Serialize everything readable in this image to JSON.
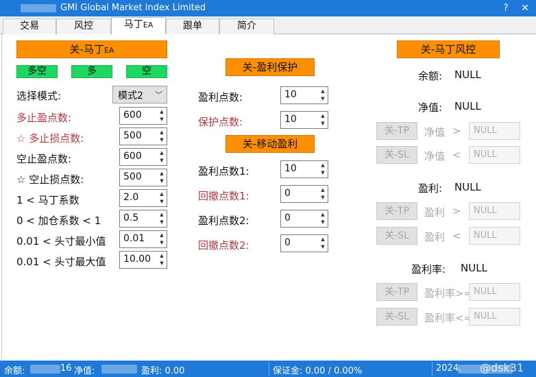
{
  "window": {
    "title": "GMI Global Market Index Limited",
    "help_glyph": "?",
    "close_glyph": "✕"
  },
  "tabs": [
    {
      "label": "交易"
    },
    {
      "label": "风控"
    },
    {
      "label": "马丁",
      "sub": "EA"
    },
    {
      "label": "跟单"
    },
    {
      "label": "简介"
    }
  ],
  "left": {
    "toggle_main": {
      "label": "关-马丁",
      "sub": "EA"
    },
    "direction_buttons": [
      "多空",
      "多",
      "空"
    ],
    "mode": {
      "label": "选择模式:",
      "value": "模式2"
    },
    "params": [
      {
        "label": "多止盈点数:",
        "value": "600"
      },
      {
        "label": "☆ 多止损点数:",
        "value": "500"
      },
      {
        "label": "空止盈点数:",
        "value": "600"
      },
      {
        "label": "☆ 空止损点数:",
        "value": "500"
      },
      {
        "label": "1 < 马丁系数",
        "value": "2.0"
      },
      {
        "label": "0 < 加仓系数 < 1",
        "value": "0.5"
      },
      {
        "label": "0.01 < 头寸最小值",
        "value": "0.01"
      },
      {
        "label": "0.01 < 头寸最大值",
        "value": "10.00"
      }
    ]
  },
  "middle": {
    "profit_protect_button": "关-盈利保护",
    "profit_points_label": "盈利点数:",
    "profit_points_value": "10",
    "protect_points_label": "保护点数:",
    "protect_points_value": "10",
    "trailing_button": "关-移动盈利",
    "trail": [
      {
        "label": "盈利点数1:",
        "value": "10"
      },
      {
        "label": "回撤点数1:",
        "value": "0"
      },
      {
        "label": "盈利点数2:",
        "value": "0"
      },
      {
        "label": "回撤点数2:",
        "value": "0"
      }
    ]
  },
  "right": {
    "risk_button": "关-马丁风控",
    "balance": {
      "label": "余额:",
      "value": "NULL"
    },
    "equity": {
      "label": "净值:",
      "value": "NULL"
    },
    "equity_rows": [
      {
        "button": "关-TP",
        "label": "净值",
        "op": ">",
        "value": "NULL"
      },
      {
        "button": "关-SL",
        "label": "净值",
        "op": "<",
        "value": "NULL"
      }
    ],
    "profit": {
      "label": "盈利:",
      "value": "NULL"
    },
    "profit_rows": [
      {
        "button": "关-TP",
        "label": "盈利",
        "op": ">",
        "value": "NULL"
      },
      {
        "button": "关-SL",
        "label": "盈利",
        "op": "<",
        "value": "NULL"
      }
    ],
    "profit_rate": {
      "label": "盈利率:",
      "value": "NULL"
    },
    "rate_rows": [
      {
        "button": "关-TP",
        "label": "盈利率>=",
        "value": "NULL"
      },
      {
        "button": "关-SL",
        "label": "盈利率<=",
        "value": "NULL"
      }
    ]
  },
  "statusbar": {
    "balance_label": "余额:",
    "balance_tail": "16",
    "equity_label": "净值:",
    "profit": "盈利: 0.00",
    "margin": "保证金: 0.00 / 0.00%",
    "date": "2024.",
    "watermark": "@dsk31"
  }
}
